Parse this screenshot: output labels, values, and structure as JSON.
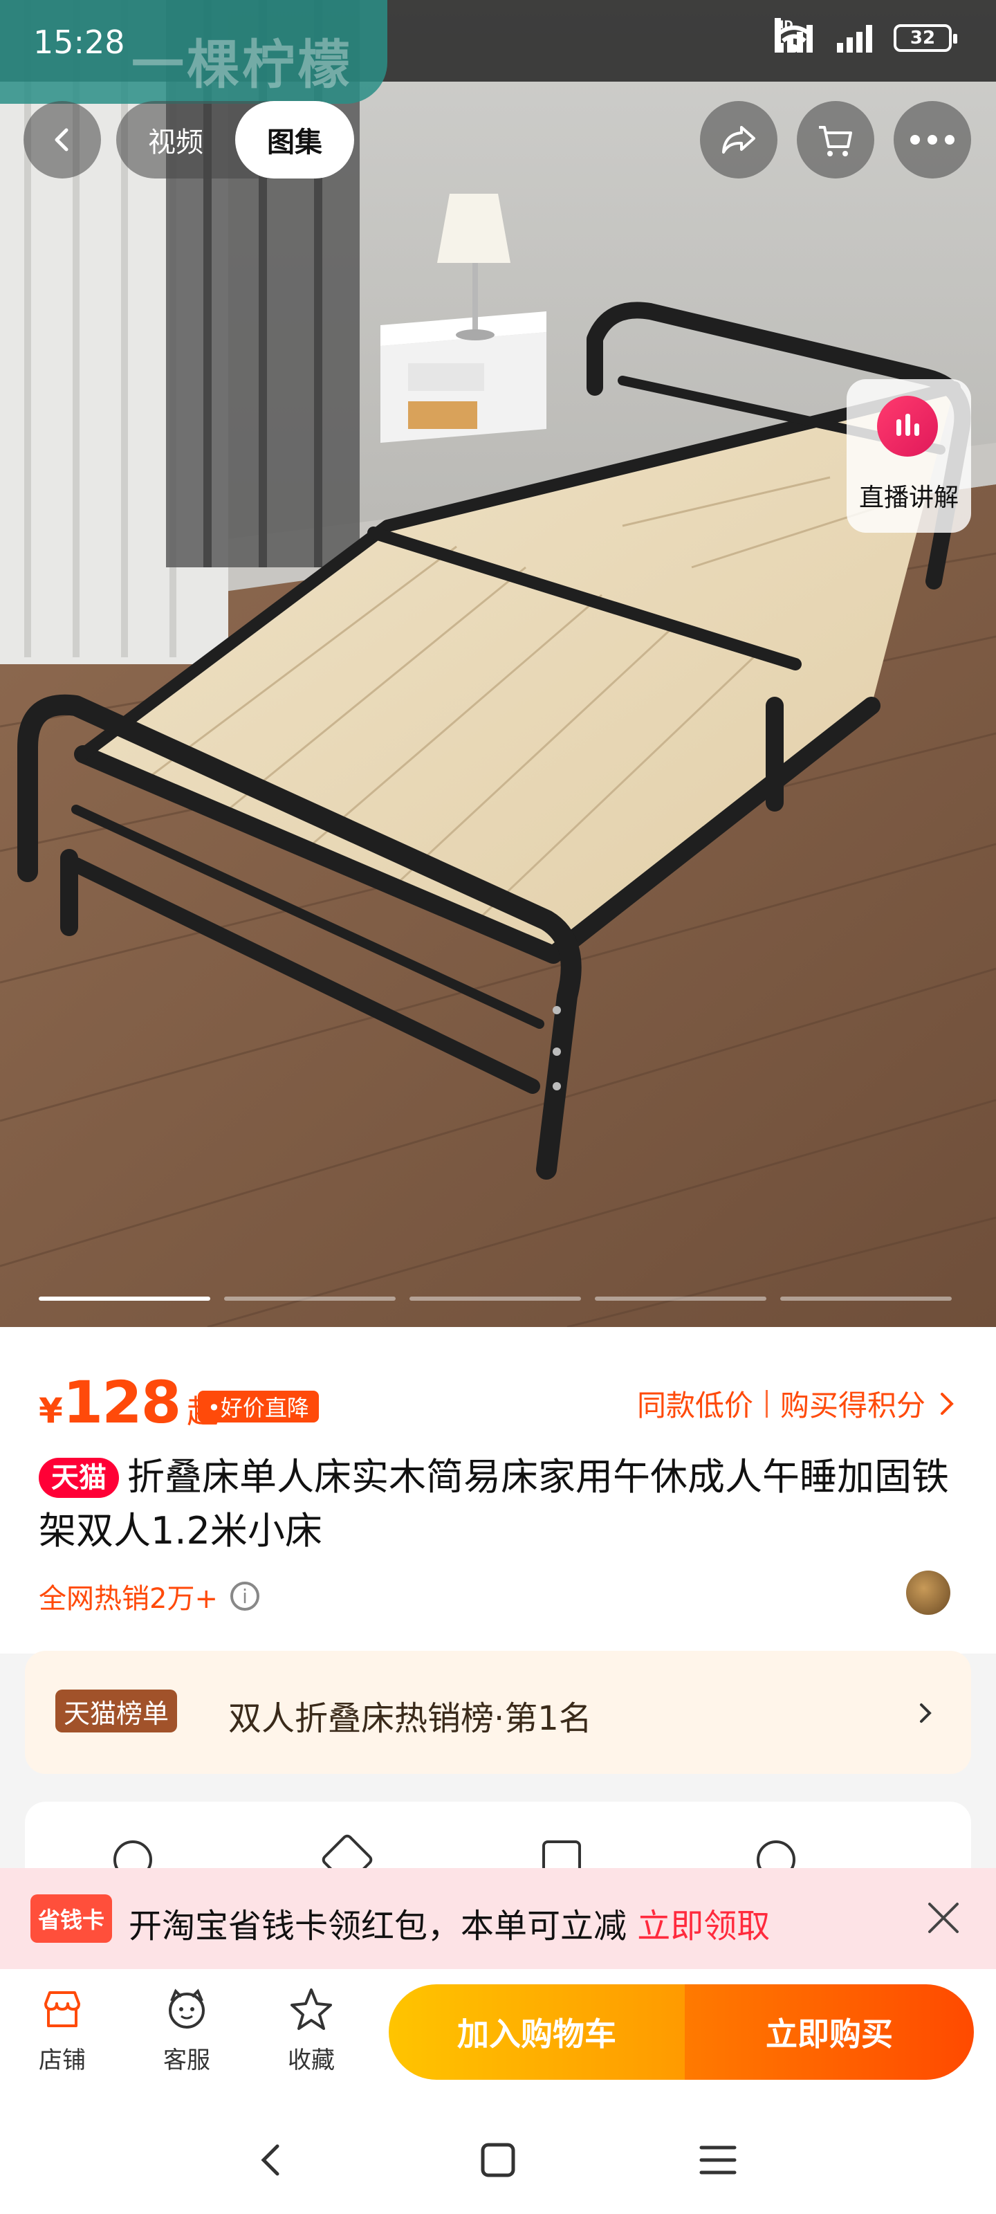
{
  "status_bar": {
    "time": "15:28",
    "network_badge": "HD",
    "battery": "32"
  },
  "watermark": {
    "brand": "一棵柠檬"
  },
  "media_tabs": [
    {
      "label": "视频"
    },
    {
      "label": "图集"
    }
  ],
  "live": {
    "label": "直播讲解"
  },
  "gallery": {
    "total_slides": 5,
    "current_slide": 1
  },
  "price": {
    "symbol": "¥",
    "value": "128",
    "suffix": "起",
    "tag": "•好价直降",
    "links": [
      "同款低价",
      "购买得积分"
    ]
  },
  "product": {
    "badge": "天猫",
    "title": "折叠床单人床实木简易床家用午休成人午睡加固铁架双人1.2米小床",
    "sales": "全网热销2万+"
  },
  "ranking": {
    "badge": "天猫榜单",
    "text": "双人折叠床热销榜·第1名"
  },
  "promo": {
    "badge": "省钱卡",
    "text": "开淘宝省钱卡领红包，本单可立减",
    "link": "立即领取"
  },
  "actions": {
    "shop": "店铺",
    "service": "客服",
    "favorite": "收藏",
    "add_to_cart": "加入购物车",
    "buy_now": "立即购买"
  },
  "colors": {
    "accent": "#ff4a0a",
    "tmall": "#ff0036",
    "cart": "#ffb400",
    "buy": "#ff5a00"
  },
  "icons": [
    "back-icon",
    "share-icon",
    "cart-icon",
    "more-icon",
    "live-icon",
    "chevron-right-icon",
    "info-icon",
    "close-icon",
    "shop-icon",
    "service-icon",
    "star-icon"
  ]
}
